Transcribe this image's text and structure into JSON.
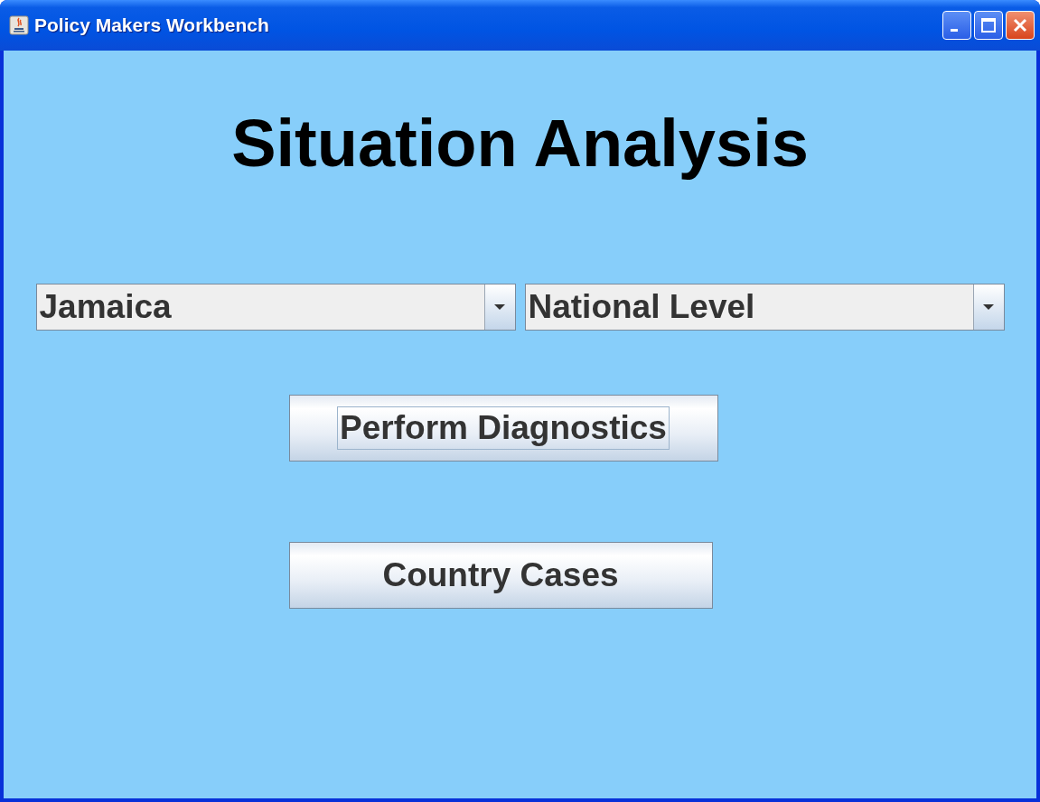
{
  "window": {
    "title": "Policy Makers Workbench"
  },
  "heading": "Situation Analysis",
  "dropdowns": [
    {
      "value": "Jamaica"
    },
    {
      "value": "National Level"
    }
  ],
  "buttons": [
    {
      "label": "Perform Diagnostics",
      "focused": true
    },
    {
      "label": "Country Cases",
      "focused": false
    }
  ]
}
